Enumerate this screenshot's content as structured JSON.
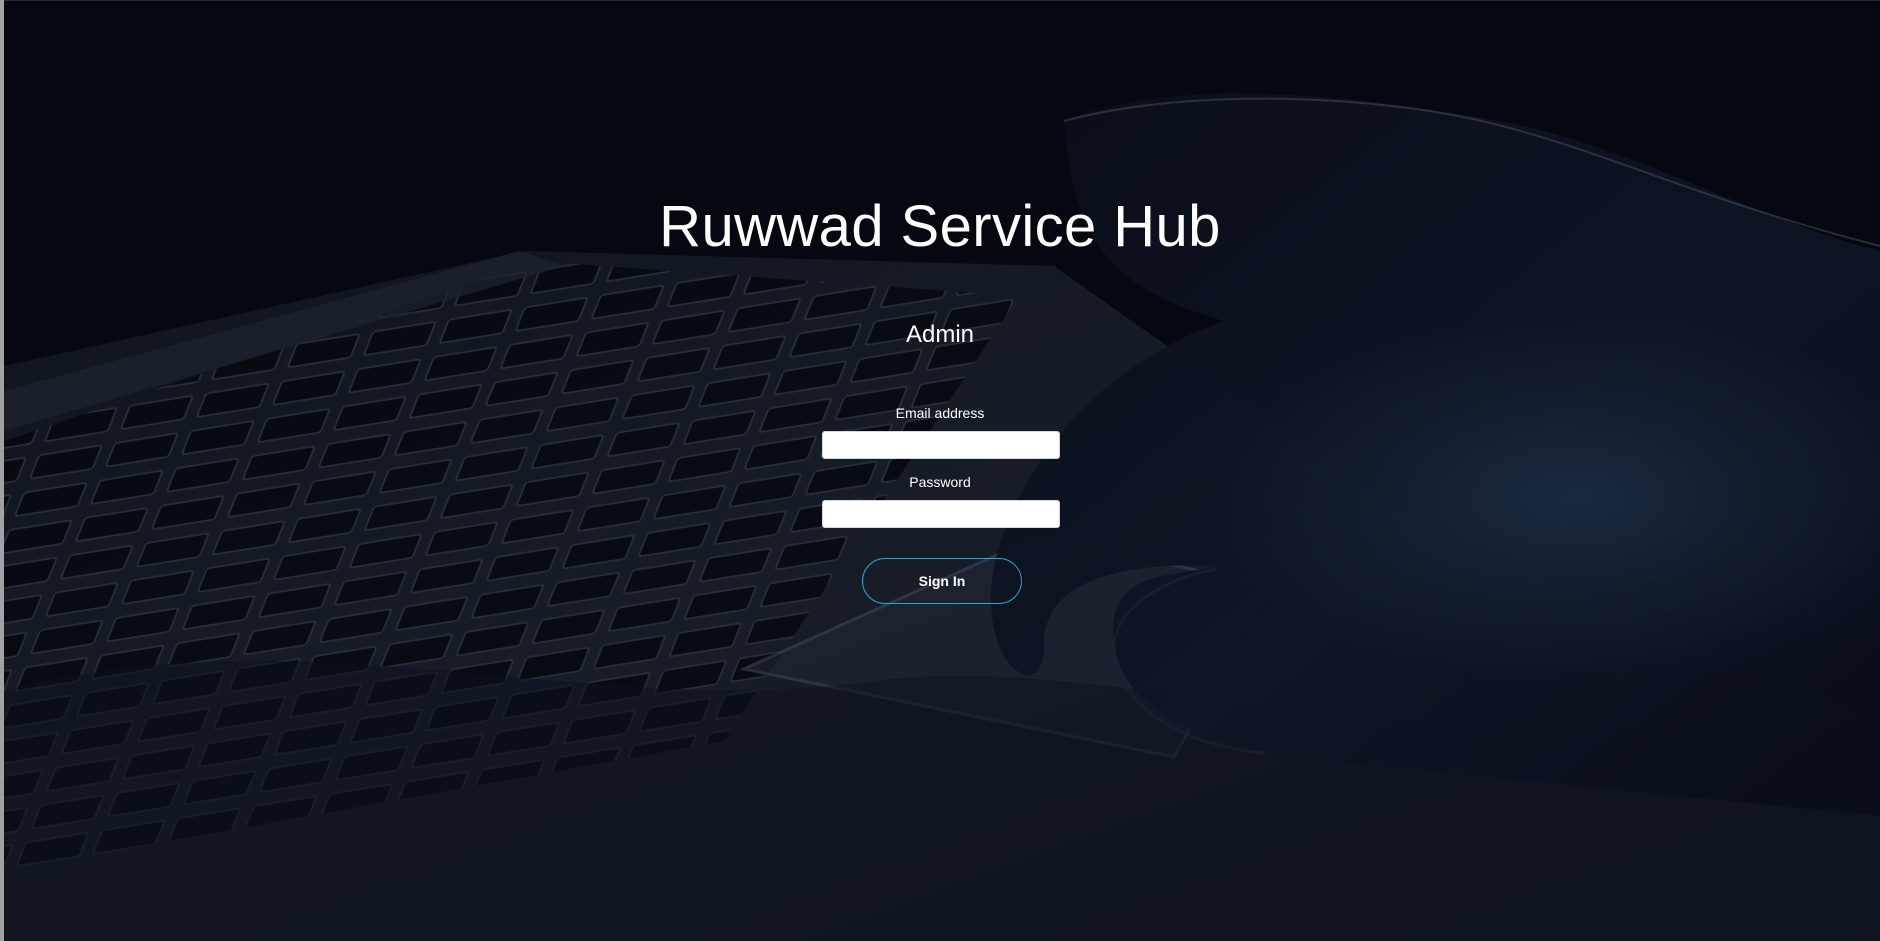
{
  "app": {
    "title": "Ruwwad Service Hub",
    "role": "Admin"
  },
  "login": {
    "email_label": "Email address",
    "email_value": "",
    "password_label": "Password",
    "password_value": "",
    "signin_label": "Sign In"
  },
  "visual": {
    "background_image": "laptop-keyboard-and-hand",
    "accent_color": "#20a8ce",
    "text_color": "#ffffff",
    "input_background": "#ffffff"
  }
}
